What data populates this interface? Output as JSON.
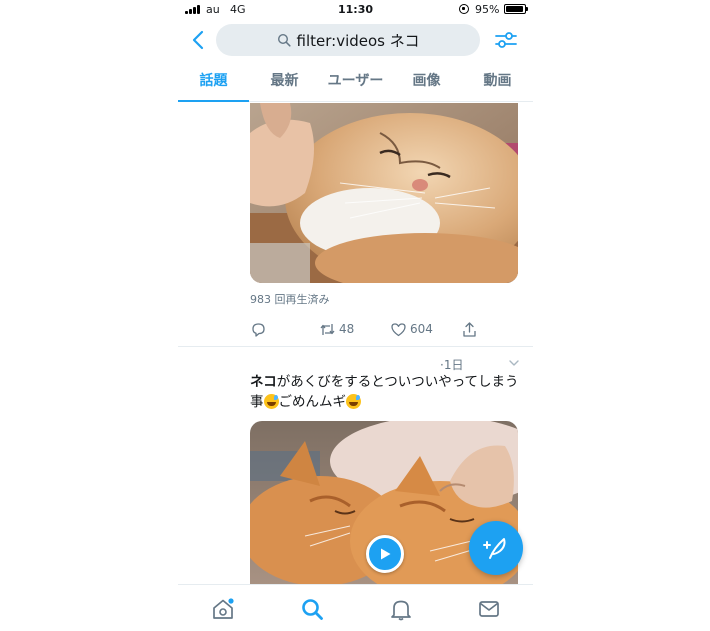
{
  "status_bar": {
    "carrier": "au",
    "network": "4G",
    "time": "11:30",
    "battery": "95%"
  },
  "search": {
    "query": "filter:videos ネコ"
  },
  "tabs": [
    {
      "label": "話題",
      "active": true
    },
    {
      "label": "最新",
      "active": false
    },
    {
      "label": "ユーザー",
      "active": false
    },
    {
      "label": "画像",
      "active": false
    },
    {
      "label": "動画",
      "active": false
    }
  ],
  "tweets": [
    {
      "views": "983 回再生済み",
      "retweets": "48",
      "likes": "604"
    },
    {
      "time": "·1日",
      "text_bold": "ネコ",
      "text_line1_rest": "があくびをするとついついやってしまう",
      "text_line2_a": "事",
      "text_line2_b": "ごめんムギ"
    }
  ],
  "colors": {
    "accent": "#1da1f2",
    "muted": "#657786",
    "divider": "#e6ecf0"
  },
  "icons": [
    "back-icon",
    "search-icon",
    "filter-icon",
    "reply-icon",
    "retweet-icon",
    "like-icon",
    "share-icon",
    "caret-down-icon",
    "play-icon",
    "compose-icon",
    "home-icon",
    "explore-icon",
    "notifications-icon",
    "messages-icon"
  ]
}
